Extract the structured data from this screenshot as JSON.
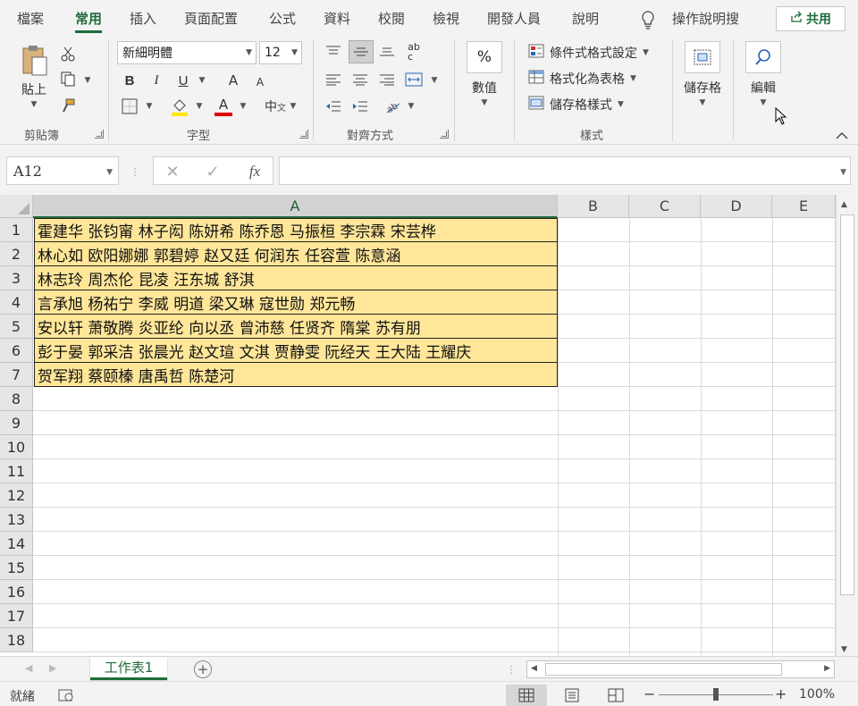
{
  "tabs": [
    "檔案",
    "常用",
    "插入",
    "頁面配置",
    "公式",
    "資料",
    "校閱",
    "檢視",
    "開發人員",
    "說明"
  ],
  "tell_me": "操作說明搜",
  "share": "共用",
  "clipboard": {
    "paste": "貼上",
    "group": "剪貼簿"
  },
  "font": {
    "name": "新細明體",
    "size": "12",
    "group": "字型",
    "bold": "B",
    "italic": "I",
    "underline": "U",
    "grow": "A",
    "shrink": "A",
    "color_letter": "A",
    "phonetic": "中"
  },
  "alignment": {
    "group": "對齊方式"
  },
  "number": {
    "label": "數值",
    "symbol": "%"
  },
  "styles": {
    "conditional": "條件式格式設定",
    "as_table": "格式化為表格",
    "cell_styles": "儲存格樣式",
    "group": "樣式"
  },
  "cells": {
    "label": "儲存格"
  },
  "editing": {
    "label": "編輯"
  },
  "formula_bar": {
    "name_box": "A12",
    "fx": "fx",
    "content": ""
  },
  "columns": [
    "A",
    "B",
    "C",
    "D",
    "E"
  ],
  "rows": [
    "1",
    "2",
    "3",
    "4",
    "5",
    "6",
    "7",
    "8",
    "9",
    "10",
    "11",
    "12",
    "13",
    "14",
    "15",
    "16",
    "17",
    "18"
  ],
  "cells_a": [
    "霍建华 张钧甯 林子闳 陈妍希 陈乔恩 马振桓 李宗霖 宋芸桦",
    "林心如 欧阳娜娜  郭碧婷 赵又廷 何润东 任容萱 陈意涵",
    "林志玲 周杰伦 昆凌 汪东城 舒淇",
    "言承旭 杨祐宁 李威 明道 梁又琳 寇世勋 郑元畅",
    "安以轩 萧敬腾 炎亚纶 向以丞 曾沛慈 任贤齐 隋棠 苏有朋",
    "彭于晏 郭采洁 张晨光 赵文瑄 文淇 贾静雯 阮经天 王大陆 王耀庆",
    "贺军翔 蔡颐榛 唐禹哲 陈楚河"
  ],
  "sheet_tab": "工作表1",
  "status": {
    "ready": "就緒",
    "zoom": "100%"
  },
  "colors": {
    "accent": "#1f6b3a",
    "cell_fill": "#ffe699"
  }
}
